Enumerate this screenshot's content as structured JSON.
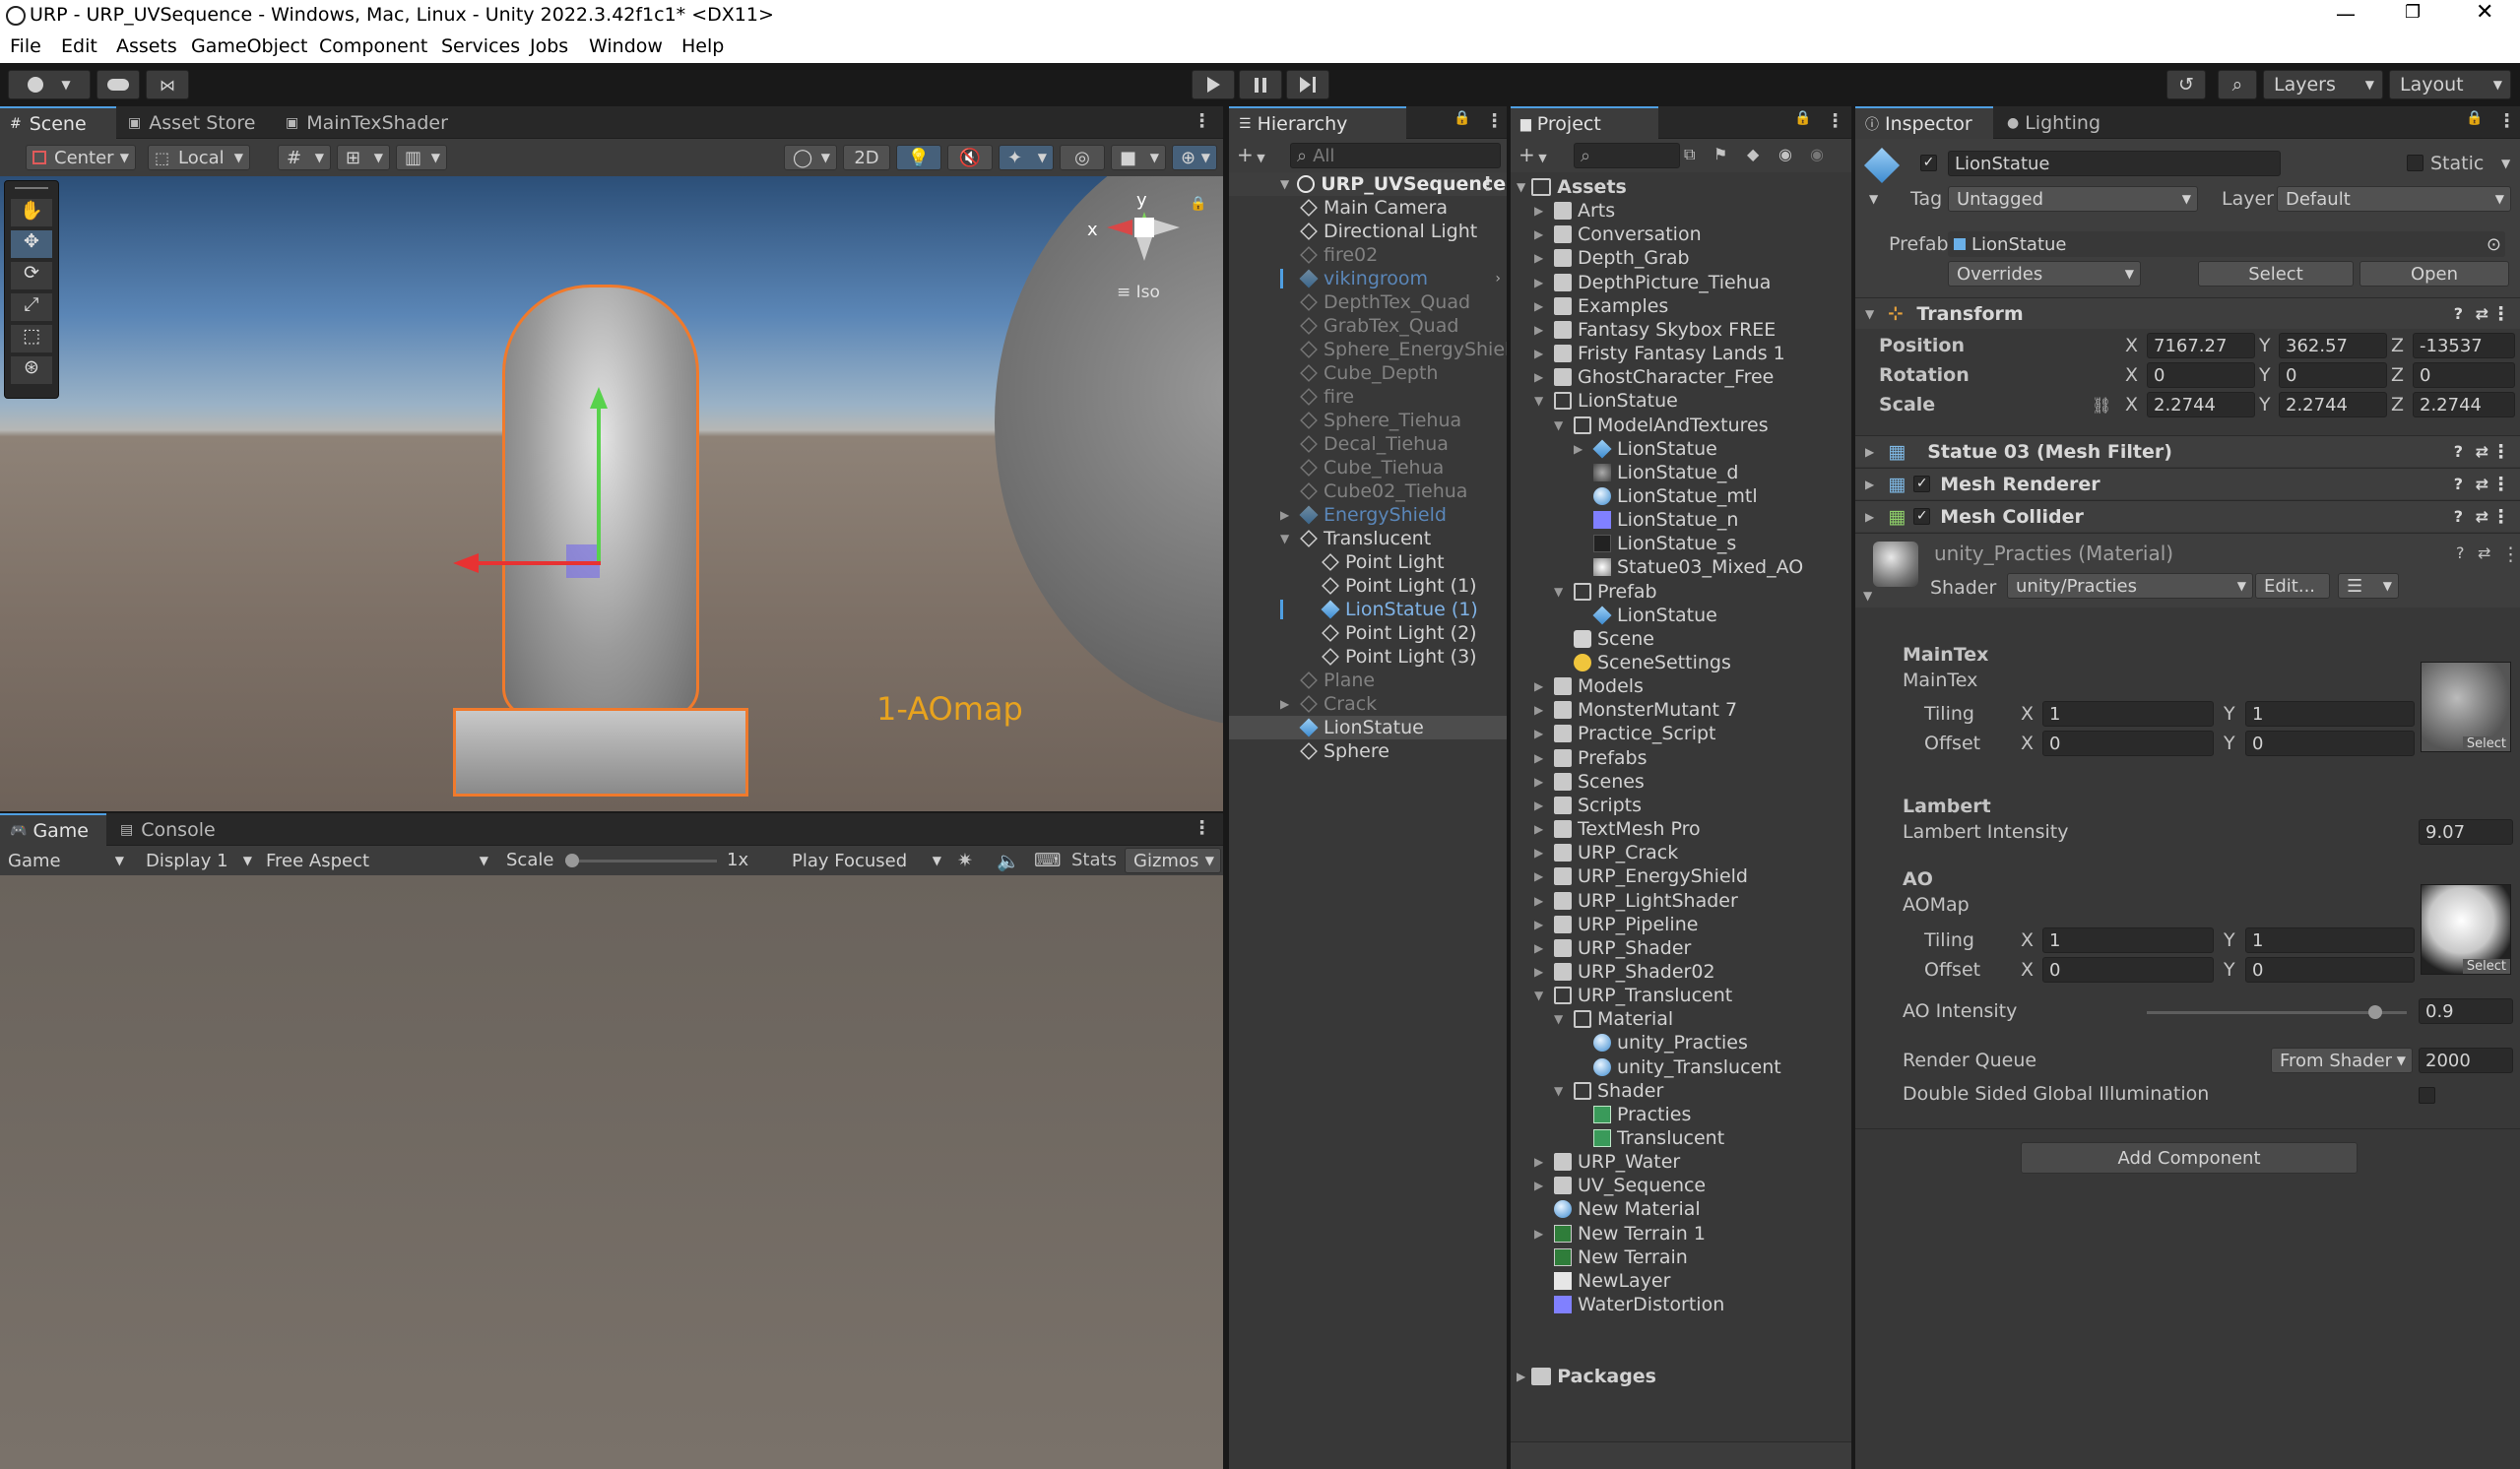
{
  "window": {
    "title": "URP - URP_UVSequence - Windows, Mac, Linux - Unity 2022.3.42f1c1* <DX11>"
  },
  "menu": [
    "File",
    "Edit",
    "Assets",
    "GameObject",
    "Component",
    "Services",
    "Jobs",
    "Window",
    "Help"
  ],
  "toolbar": {
    "layers": "Layers",
    "layout": "Layout"
  },
  "scene": {
    "tabs": [
      "Scene",
      "Asset Store",
      "MainTexShader"
    ],
    "pivot": "Center",
    "space": "Local",
    "mode2d": "2D",
    "axis_x": "x",
    "axis_y": "y",
    "iso": "Iso",
    "label": "1-AOmap",
    "label_color": "#e8a31e"
  },
  "game": {
    "tabs": [
      "Game",
      "Console"
    ],
    "view": "Game",
    "display": "Display 1",
    "aspect": "Free Aspect",
    "scale_label": "Scale",
    "scale_value": "1x",
    "play_mode": "Play Focused",
    "stats": "Stats",
    "gizmos": "Gizmos"
  },
  "hierarchy": {
    "tab": "Hierarchy",
    "search": "All",
    "scene_name": "URP_UVSequence",
    "items": [
      {
        "label": "Main Camera",
        "depth": 1,
        "style": "normal"
      },
      {
        "label": "Directional Light",
        "depth": 1,
        "style": "normal"
      },
      {
        "label": "fire02",
        "depth": 1,
        "style": "dim"
      },
      {
        "label": "vikingroom",
        "depth": 1,
        "style": "dim-blue"
      },
      {
        "label": "DepthTex_Quad",
        "depth": 1,
        "style": "dim"
      },
      {
        "label": "GrabTex_Quad",
        "depth": 1,
        "style": "dim"
      },
      {
        "label": "Sphere_EnergyShield",
        "depth": 1,
        "style": "dim"
      },
      {
        "label": "Cube_Depth",
        "depth": 1,
        "style": "dim"
      },
      {
        "label": "fire",
        "depth": 1,
        "style": "dim"
      },
      {
        "label": "Sphere_Tiehua",
        "depth": 1,
        "style": "dim"
      },
      {
        "label": "Decal_Tiehua",
        "depth": 1,
        "style": "dim"
      },
      {
        "label": "Cube_Tiehua",
        "depth": 1,
        "style": "dim"
      },
      {
        "label": "Cube02_Tiehua",
        "depth": 1,
        "style": "dim"
      },
      {
        "label": "EnergyShield",
        "depth": 1,
        "style": "dim-blue"
      },
      {
        "label": "Translucent",
        "depth": 1,
        "style": "normal"
      },
      {
        "label": "Point Light",
        "depth": 2,
        "style": "normal"
      },
      {
        "label": "Point Light (1)",
        "depth": 2,
        "style": "normal"
      },
      {
        "label": "LionStatue (1)",
        "depth": 2,
        "style": "blue"
      },
      {
        "label": "Point Light (2)",
        "depth": 2,
        "style": "normal"
      },
      {
        "label": "Point Light (3)",
        "depth": 2,
        "style": "normal"
      },
      {
        "label": "Plane",
        "depth": 1,
        "style": "dim"
      },
      {
        "label": "Crack",
        "depth": 1,
        "style": "dim"
      },
      {
        "label": "LionStatue",
        "depth": 1,
        "style": "selected"
      },
      {
        "label": "Sphere",
        "depth": 1,
        "style": "normal"
      }
    ]
  },
  "project": {
    "tab": "Project",
    "root": "Assets",
    "packages": "Packages",
    "items": [
      {
        "label": "Arts",
        "depth": 1,
        "icon": "folder"
      },
      {
        "label": "Conversation",
        "depth": 1,
        "icon": "folder"
      },
      {
        "label": "Depth_Grab",
        "depth": 1,
        "icon": "folder"
      },
      {
        "label": "DepthPicture_Tiehua",
        "depth": 1,
        "icon": "folder"
      },
      {
        "label": "Examples",
        "depth": 1,
        "icon": "folder"
      },
      {
        "label": "Fantasy Skybox FREE",
        "depth": 1,
        "icon": "folder"
      },
      {
        "label": "Fristy Fantasy Lands 1",
        "depth": 1,
        "icon": "folder"
      },
      {
        "label": "GhostCharacter_Free",
        "depth": 1,
        "icon": "folder"
      },
      {
        "label": "LionStatue",
        "depth": 1,
        "icon": "folder-open"
      },
      {
        "label": "ModelAndTextures",
        "depth": 2,
        "icon": "folder-open"
      },
      {
        "label": "LionStatue",
        "depth": 3,
        "icon": "mesh"
      },
      {
        "label": "LionStatue_d",
        "depth": 3,
        "icon": "texture"
      },
      {
        "label": "LionStatue_mtl",
        "depth": 3,
        "icon": "material"
      },
      {
        "label": "LionStatue_n",
        "depth": 3,
        "icon": "normal"
      },
      {
        "label": "LionStatue_s",
        "depth": 3,
        "icon": "texture-dark"
      },
      {
        "label": "Statue03_Mixed_AO",
        "depth": 3,
        "icon": "texture-light"
      },
      {
        "label": "Prefab",
        "depth": 2,
        "icon": "folder-open"
      },
      {
        "label": "LionStatue",
        "depth": 3,
        "icon": "prefab"
      },
      {
        "label": "Scene",
        "depth": 2,
        "icon": "scene"
      },
      {
        "label": "SceneSettings",
        "depth": 2,
        "icon": "settings"
      },
      {
        "label": "Models",
        "depth": 1,
        "icon": "folder"
      },
      {
        "label": "MonsterMutant 7",
        "depth": 1,
        "icon": "folder"
      },
      {
        "label": "Practice_Script",
        "depth": 1,
        "icon": "folder"
      },
      {
        "label": "Prefabs",
        "depth": 1,
        "icon": "folder"
      },
      {
        "label": "Scenes",
        "depth": 1,
        "icon": "folder"
      },
      {
        "label": "Scripts",
        "depth": 1,
        "icon": "folder"
      },
      {
        "label": "TextMesh Pro",
        "depth": 1,
        "icon": "folder"
      },
      {
        "label": "URP_Crack",
        "depth": 1,
        "icon": "folder"
      },
      {
        "label": "URP_EnergyShield",
        "depth": 1,
        "icon": "folder"
      },
      {
        "label": "URP_LightShader",
        "depth": 1,
        "icon": "folder"
      },
      {
        "label": "URP_Pipeline",
        "depth": 1,
        "icon": "folder"
      },
      {
        "label": "URP_Shader",
        "depth": 1,
        "icon": "folder"
      },
      {
        "label": "URP_Shader02",
        "depth": 1,
        "icon": "folder"
      },
      {
        "label": "URP_Translucent",
        "depth": 1,
        "icon": "folder-open"
      },
      {
        "label": "Material",
        "depth": 2,
        "icon": "folder-open"
      },
      {
        "label": "unity_Practies",
        "depth": 3,
        "icon": "material"
      },
      {
        "label": "unity_Translucent",
        "depth": 3,
        "icon": "material"
      },
      {
        "label": "Shader",
        "depth": 2,
        "icon": "folder-open"
      },
      {
        "label": "Practies",
        "depth": 3,
        "icon": "shader"
      },
      {
        "label": "Translucent",
        "depth": 3,
        "icon": "shader"
      },
      {
        "label": "URP_Water",
        "depth": 1,
        "icon": "folder"
      },
      {
        "label": "UV_Sequence",
        "depth": 1,
        "icon": "folder"
      },
      {
        "label": "New Material",
        "depth": 1,
        "icon": "material"
      },
      {
        "label": "New Terrain 1",
        "depth": 1,
        "icon": "terrain"
      },
      {
        "label": "New Terrain",
        "depth": 1,
        "icon": "terrain"
      },
      {
        "label": "NewLayer",
        "depth": 1,
        "icon": "file"
      },
      {
        "label": "WaterDistortion",
        "depth": 1,
        "icon": "normal"
      }
    ]
  },
  "inspector": {
    "tabs": [
      "Inspector",
      "Lighting"
    ],
    "object_name": "LionStatue",
    "static_label": "Static",
    "tag_label": "Tag",
    "tag_value": "Untagged",
    "layer_label": "Layer",
    "layer_value": "Default",
    "prefab_label": "Prefab",
    "prefab_value": "LionStatue",
    "overrides": "Overrides",
    "select": "Select",
    "open": "Open",
    "transform": {
      "title": "Transform",
      "position_label": "Position",
      "rotation_label": "Rotation",
      "scale_label": "Scale",
      "position": {
        "x": "7167.27",
        "y": "362.57",
        "z": "-13537"
      },
      "rotation": {
        "x": "0",
        "y": "0",
        "z": "0"
      },
      "scale": {
        "x": "2.2744",
        "y": "2.2744",
        "z": "2.2744"
      },
      "axis_x": "X",
      "axis_y": "Y",
      "axis_z": "Z"
    },
    "mesh_filter": "Statue 03 (Mesh Filter)",
    "mesh_renderer": "Mesh Renderer",
    "mesh_collider": "Mesh Collider",
    "material": {
      "name": "unity_Practies (Material)",
      "shader_label": "Shader",
      "shader_value": "unity/Practies",
      "edit": "Edit...",
      "maintex_header": "MainTex",
      "maintex_label": "MainTex",
      "tiling_label": "Tiling",
      "offset_label": "Offset",
      "maintex_tiling": {
        "x": "1",
        "y": "1"
      },
      "maintex_offset": {
        "x": "0",
        "y": "0"
      },
      "lambert_header": "Lambert",
      "lambert_label": "Lambert Intensity",
      "lambert_value": "9.07",
      "ao_header": "AO",
      "aomap_label": "AOMap",
      "ao_tiling": {
        "x": "1",
        "y": "1"
      },
      "ao_offset": {
        "x": "0",
        "y": "0"
      },
      "ao_intensity_label": "AO Intensity",
      "ao_intensity_value": "0.9",
      "ao_intensity_fraction": 0.9,
      "render_queue_label": "Render Queue",
      "render_queue_mode": "From Shader",
      "render_queue_value": "2000",
      "dsgi_label": "Double Sided Global Illumination",
      "select_thumb": "Select"
    },
    "add_component": "Add Component"
  }
}
